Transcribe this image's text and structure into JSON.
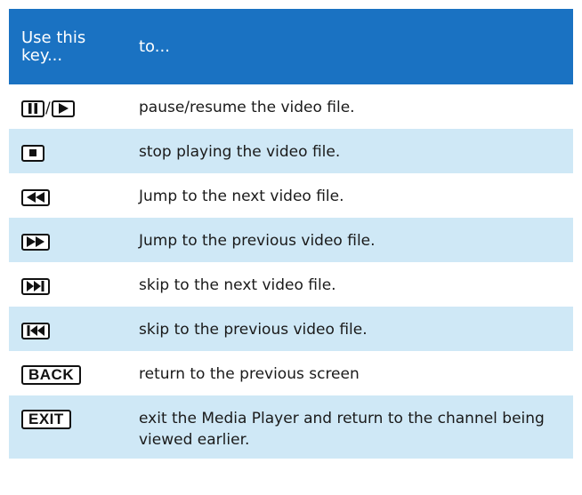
{
  "header": {
    "col1_line1": "Use this",
    "col1_line2": "key...",
    "col2": "to..."
  },
  "rows": [
    {
      "key_icons": [
        "pause-icon",
        "play-icon"
      ],
      "description": "pause/resume the video file."
    },
    {
      "key_icons": [
        "stop-icon"
      ],
      "description": "stop playing the video file."
    },
    {
      "key_icons": [
        "rewind-icon"
      ],
      "description": "Jump to the next video file."
    },
    {
      "key_icons": [
        "fast-forward-icon"
      ],
      "description": "Jump to the previous video file."
    },
    {
      "key_icons": [
        "skip-next-icon"
      ],
      "description": "skip to the next video file."
    },
    {
      "key_icons": [
        "skip-previous-icon"
      ],
      "description": "skip to the previous video file."
    },
    {
      "key_label": "BACK",
      "description": "return to the previous screen"
    },
    {
      "key_label": "EXIT",
      "description": "exit the Media Player and return to the channel being viewed earlier."
    }
  ],
  "colors": {
    "header_bg": "#1a72c2",
    "alt_row_bg": "#cfe8f6"
  }
}
